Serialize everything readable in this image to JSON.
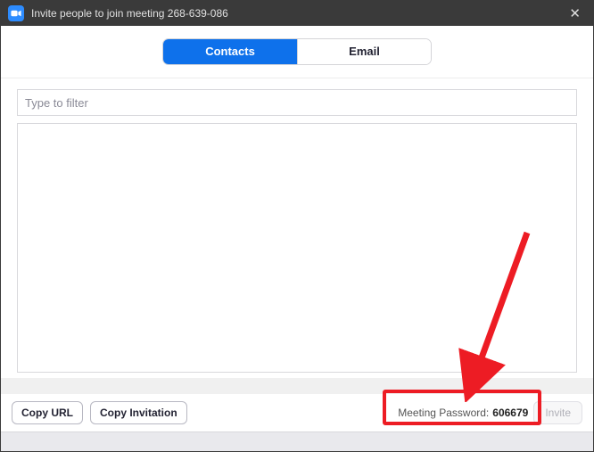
{
  "titlebar": {
    "title": "Invite people to join meeting 268-639-086"
  },
  "tabs": {
    "contacts": "Contacts",
    "email": "Email"
  },
  "filter": {
    "placeholder": "Type to filter"
  },
  "footer": {
    "copy_url": "Copy URL",
    "copy_invitation": "Copy Invitation",
    "password_label": "Meeting Password:",
    "password_value": "606679",
    "invite": "Invite"
  }
}
